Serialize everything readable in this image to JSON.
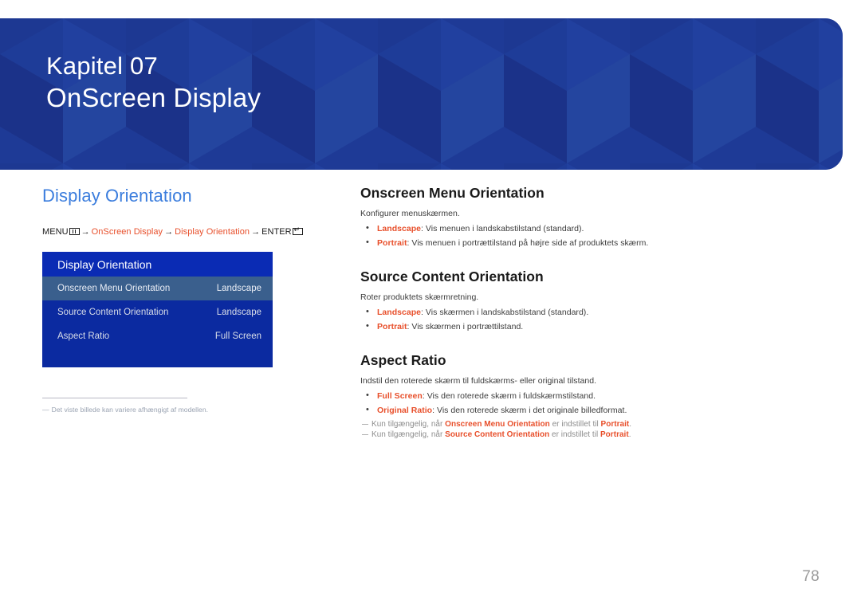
{
  "banner": {
    "chapter": "Kapitel 07",
    "title": "OnScreen Display",
    "bg_color": "#1e3a96"
  },
  "left": {
    "page_title": "Display Orientation",
    "title_color": "#3b7ddd",
    "breadcrumb": {
      "menu_label": "MENU",
      "menu_icon": "menu-bars-icon",
      "arrow": "→",
      "link1": "OnScreen Display",
      "link2": "Display Orientation",
      "enter_label": "ENTER",
      "enter_icon": "enter-return-icon",
      "link_color": "#e8502c"
    },
    "osd": {
      "header": "Display Orientation",
      "rows": [
        {
          "label": "Onscreen Menu Orientation",
          "value": "Landscape",
          "selected": true
        },
        {
          "label": "Source Content Orientation",
          "value": "Landscape",
          "selected": false
        },
        {
          "label": "Aspect Ratio",
          "value": "Full Screen",
          "selected": false
        }
      ],
      "header_color": "#0a2bb4",
      "body_color": "#0b2aa0",
      "selected_color": "#3a5f8d"
    },
    "footnote": {
      "dash": "―",
      "text": "Det viste billede kan variere afhængigt af modellen."
    }
  },
  "right": {
    "sections": [
      {
        "title": "Onscreen Menu Orientation",
        "intro": "Konfigurer menuskærmen.",
        "bullets": [
          {
            "term": "Landscape",
            "rest": ": Vis menuen i landskabstilstand (standard)."
          },
          {
            "term": "Portrait",
            "rest": ": Vis menuen i portrættilstand på højre side af produktets skærm."
          }
        ],
        "notes": []
      },
      {
        "title": "Source Content Orientation",
        "intro": "Roter produktets skærmretning.",
        "bullets": [
          {
            "term": "Landscape",
            "rest": ": Vis skærmen i landskabstilstand (standard)."
          },
          {
            "term": "Portrait",
            "rest": ": Vis skærmen i portrættilstand."
          }
        ],
        "notes": []
      },
      {
        "title": "Aspect Ratio",
        "intro": "Indstil den roterede skærm til fuldskærms- eller original tilstand.",
        "bullets": [
          {
            "term": "Full Screen",
            "rest": ": Vis den roterede skærm i fuldskærmstilstand."
          },
          {
            "term": "Original Ratio",
            "rest": ": Vis den roterede skærm i det originale billedformat."
          }
        ],
        "notes": [
          {
            "pre": "Kun tilgængelig, når ",
            "term": "Onscreen Menu Orientation",
            "mid": " er indstillet til ",
            "term2": "Portrait",
            "post": "."
          },
          {
            "pre": "Kun tilgængelig, når ",
            "term": "Source Content Orientation",
            "mid": " er indstillet til ",
            "term2": "Portrait",
            "post": "."
          }
        ]
      }
    ]
  },
  "page_number": "78"
}
